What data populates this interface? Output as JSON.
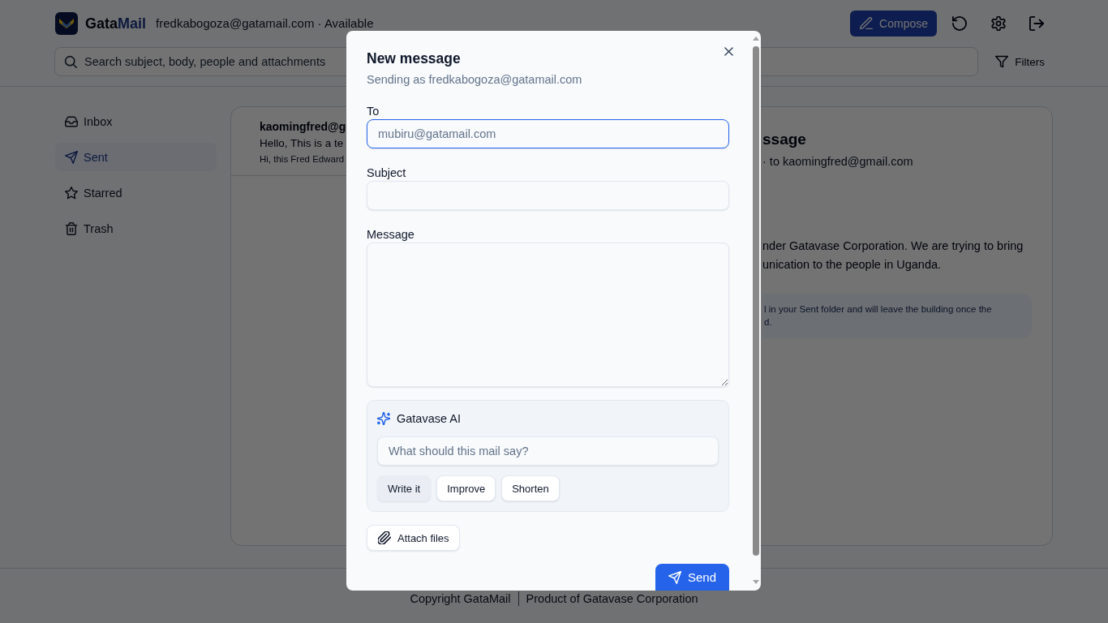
{
  "header": {
    "brand": {
      "name_start": "Gata",
      "name_end": "Mail"
    },
    "account": "fredkabogoza@gatamail.com · Available",
    "compose_button": "Compose",
    "search": {
      "placeholder": "Search subject, body, people and attachments"
    },
    "filters_button": "Filters"
  },
  "sidebar": {
    "items": [
      {
        "label": "Inbox",
        "kind": "inbox",
        "selected": false
      },
      {
        "label": "Sent",
        "kind": "sent",
        "selected": true
      },
      {
        "label": "Starred",
        "kind": "starred",
        "selected": false
      },
      {
        "label": "Trash",
        "kind": "trash",
        "selected": false
      }
    ]
  },
  "message_list": {
    "items": [
      {
        "sender": "kaomingfred@g",
        "subject": "Hello, This is a te",
        "preview": "Hi, this Fred Edward"
      }
    ]
  },
  "reading_pane": {
    "title": "ssage",
    "meta": "· to kaomingfred@gmail.com",
    "body_lines": [
      "nder Gatavase Corporation. We are trying to bring",
      "unication to the people in Uganda."
    ],
    "notice_lines": [
      "l in your Sent folder and will leave the building once the",
      "d."
    ]
  },
  "footer": {
    "items": [
      "Copyright GataMail",
      "Product of Gatavase Corporation"
    ]
  },
  "compose_dialog": {
    "title": "New message",
    "subtitle": "Sending as fredkabogoza@gatamail.com",
    "fields": [
      {
        "label": "To",
        "kind": "input",
        "placeholder": "mubiru@gatamail.com",
        "focused": true
      },
      {
        "label": "Subject",
        "kind": "input",
        "focused": false
      },
      {
        "label": "Message",
        "kind": "textarea",
        "focused": false
      }
    ],
    "ai": {
      "title": "Gatavase AI",
      "placeholder": "What should this mail say?",
      "actions": [
        {
          "label": "Write it",
          "hovered": true
        },
        {
          "label": "Improve",
          "hovered": false
        },
        {
          "label": "Shorten",
          "hovered": false
        }
      ]
    },
    "attach_button": "Attach files",
    "send_button": "Send"
  }
}
